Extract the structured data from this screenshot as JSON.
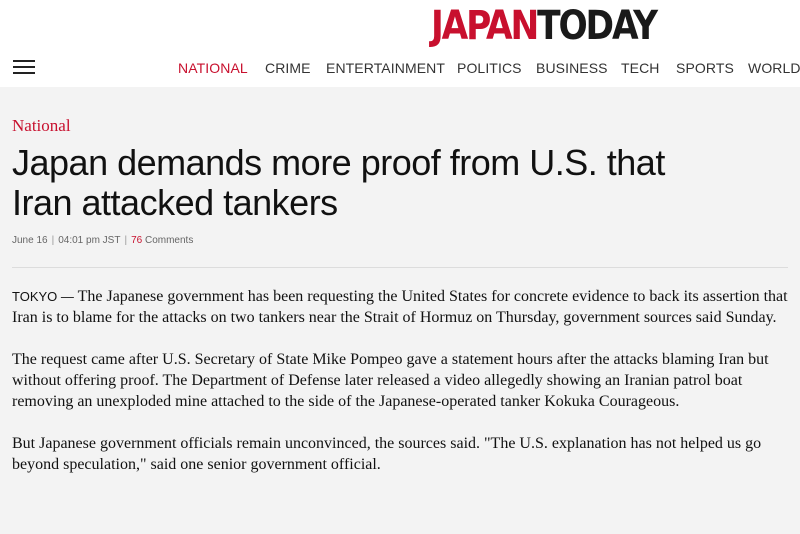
{
  "logo": {
    "part1": "JAPAN",
    "part2": "TODAY"
  },
  "nav": {
    "items": [
      {
        "label": "NATIONAL",
        "active": true
      },
      {
        "label": "CRIME"
      },
      {
        "label": "ENTERTAINMENT"
      },
      {
        "label": "POLITICS"
      },
      {
        "label": "BUSINESS"
      },
      {
        "label": "TECH"
      },
      {
        "label": "SPORTS"
      },
      {
        "label": "WORLD"
      }
    ]
  },
  "article": {
    "category": "National",
    "title": "Japan demands more proof from U.S. that Iran attacked tankers",
    "date": "June 16",
    "time": "04:01 pm JST",
    "comments_count": "76",
    "comments_label": "Comments",
    "dateline": "TOKYO —",
    "paragraphs": [
      " The Japanese government has been requesting the United States for concrete evidence to back its assertion that Iran is to blame for the attacks on two tankers near the Strait of Hormuz on Thursday, government sources said Sunday.",
      "The request came after U.S. Secretary of State Mike Pompeo gave a statement hours after the attacks blaming Iran but without offering proof. The Department of Defense later released a video allegedly showing an Iranian patrol boat removing an unexploded mine attached to the side of the Japanese-operated tanker Kokuka Courageous.",
      "But Japanese government officials remain unconvinced, the sources said. \"The U.S. explanation has not helped us go beyond speculation,\" said one senior government official."
    ]
  },
  "colors": {
    "brand_red": "#c8102e",
    "background": "#f3f3f3",
    "header_bg": "#ffffff"
  },
  "icons": {
    "menu": "hamburger-icon"
  }
}
